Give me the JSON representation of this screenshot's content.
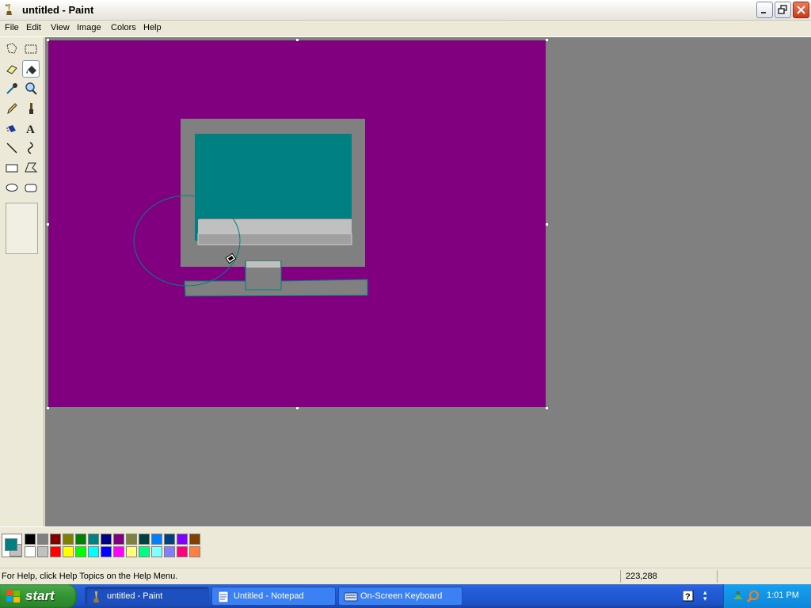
{
  "window": {
    "title": "untitled - Paint",
    "app_icon": "paint-icon",
    "controls": [
      "minimize-icon",
      "restore-icon",
      "close-icon"
    ]
  },
  "menu": {
    "file": "File",
    "edit": "Edit",
    "view": "View",
    "image": "Image",
    "colors": "Colors",
    "help": "Help"
  },
  "toolbox": {
    "tools": [
      "free-form-select-icon",
      "select-icon",
      "eraser-icon",
      "fill-bucket-icon",
      "pick-color-icon",
      "magnifier-icon",
      "pencil-icon",
      "brush-icon",
      "airbrush-icon",
      "text-icon",
      "line-icon",
      "curve-icon",
      "rectangle-icon",
      "polygon-icon",
      "ellipse-icon",
      "rounded-rectangle-icon"
    ],
    "selected_tool": "fill-bucket-icon"
  },
  "canvas": {
    "background_color": "#800080",
    "drawing_colors": {
      "monitor": "#808080",
      "screen": "#008080",
      "panel": "#c0c0c0",
      "outline": "#008080"
    }
  },
  "colors": {
    "foreground": "#008080",
    "background": "#c0c0c0",
    "palette_row1": [
      "#000000",
      "#808080",
      "#800000",
      "#808000",
      "#008000",
      "#008080",
      "#000080",
      "#800080",
      "#808040",
      "#004040",
      "#0080ff",
      "#004080",
      "#8000ff",
      "#804000"
    ],
    "palette_row2": [
      "#ffffff",
      "#c0c0c0",
      "#ff0000",
      "#ffff00",
      "#00ff00",
      "#00ffff",
      "#0000ff",
      "#ff00ff",
      "#ffff80",
      "#00ff80",
      "#80ffff",
      "#8080ff",
      "#ff0080",
      "#ff8040"
    ]
  },
  "status": {
    "help_text": "For Help, click Help Topics on the Help Menu.",
    "coordinates": "223,288"
  },
  "taskbar": {
    "start_label": "start",
    "tasks": [
      {
        "label": "untitled - Paint",
        "icon": "paint-icon",
        "active": true
      },
      {
        "label": "Untitled - Notepad",
        "icon": "notepad-icon",
        "active": false
      },
      {
        "label": "On-Screen Keyboard",
        "icon": "keyboard-icon",
        "active": false
      }
    ],
    "clock": "1:01 PM"
  }
}
